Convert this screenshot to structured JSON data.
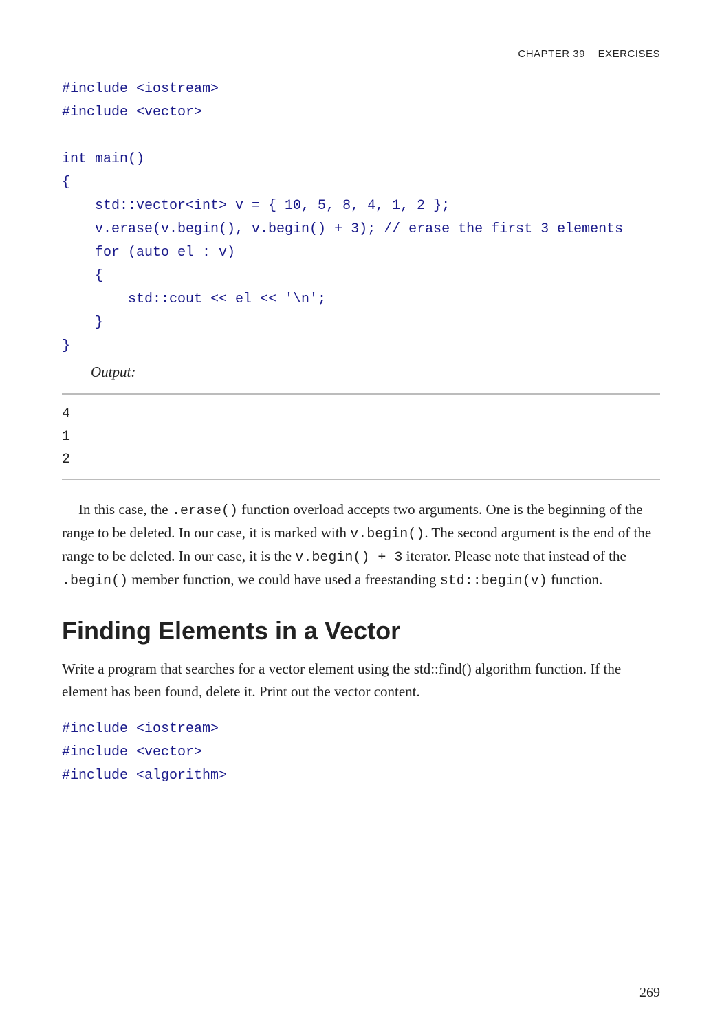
{
  "header": {
    "chapter": "CHAPTER 39",
    "title": "EXERCISES"
  },
  "code1": "#include <iostream>\n#include <vector>\n\nint main()\n{\n    std::vector<int> v = { 10, 5, 8, 4, 1, 2 };\n    v.erase(v.begin(), v.begin() + 3); // erase the first 3 elements\n    for (auto el : v)\n    {\n        std::cout << el << '\\n';\n    }\n}",
  "output_label": "Output:",
  "output_lines": [
    "4",
    "1",
    "2"
  ],
  "para1_pre": "In this case, the ",
  "para1_c1": ".erase()",
  "para1_mid1": " function overload accepts two arguments. One is the beginning of the range to be deleted. In our case, it is marked with ",
  "para1_c2": "v.begin()",
  "para1_mid2": ". The second argument is the end of the range to be deleted. In our case, it is the ",
  "para1_c3": "v.begin() + 3",
  "para1_mid3": " iterator. Please note that instead of the ",
  "para1_c4": ".begin()",
  "para1_mid4": " member function, we could have used a freestanding ",
  "para1_c5": "std::begin(v)",
  "para1_end": " function.",
  "section_title": "Finding Elements in a Vector",
  "para2": "Write a program that searches for a vector element using the std::find() algorithm function. If the element has been found, delete it. Print out the vector content.",
  "code2": "#include <iostream>\n#include <vector>\n#include <algorithm>",
  "page_number": "269"
}
